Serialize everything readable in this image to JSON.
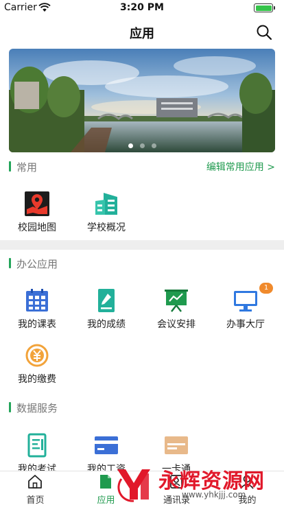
{
  "status_bar": {
    "carrier": "Carrier",
    "time": "3:20 PM",
    "battery_color": "#35c44a"
  },
  "nav": {
    "title": "应用"
  },
  "banner": {
    "dots": 3,
    "active_dot": 0
  },
  "sections": {
    "common": {
      "title": "常用",
      "edit_link": "编辑常用应用 >"
    },
    "office": {
      "title": "办公应用"
    },
    "data": {
      "title": "数据服务"
    }
  },
  "apps": {
    "campus_map": {
      "label": "校园地图",
      "icon": "map-pin-icon"
    },
    "school_overview": {
      "label": "学校概况",
      "icon": "building-icon"
    },
    "my_schedule": {
      "label": "我的课表",
      "icon": "calendar-icon"
    },
    "my_grades": {
      "label": "我的成绩",
      "icon": "report-card-icon"
    },
    "meetings": {
      "label": "会议安排",
      "icon": "presentation-board-icon"
    },
    "service_hall": {
      "label": "办事大厅",
      "icon": "monitor-icon",
      "badge": "1"
    },
    "my_payments": {
      "label": "我的缴费",
      "icon": "yuan-coin-icon"
    },
    "my_exams": {
      "label": "我的考试",
      "icon": "exam-sheet-icon"
    },
    "my_salary": {
      "label": "我的工资",
      "icon": "bank-card-icon"
    },
    "campus_card": {
      "label": "一卡通",
      "icon": "id-card-icon"
    }
  },
  "tabs": [
    {
      "label": "首页",
      "icon": "home-icon"
    },
    {
      "label": "应用",
      "icon": "document-icon",
      "active": true
    },
    {
      "label": "通讯录",
      "icon": "contacts-icon"
    },
    {
      "label": "我的",
      "icon": "profile-icon"
    }
  ],
  "watermark": {
    "text": "永辉资源网",
    "url": "www.yhkjjj.com"
  },
  "colors": {
    "accent": "#1f9a4e",
    "badge": "#f08a2c",
    "watermark": "#e1182a"
  }
}
